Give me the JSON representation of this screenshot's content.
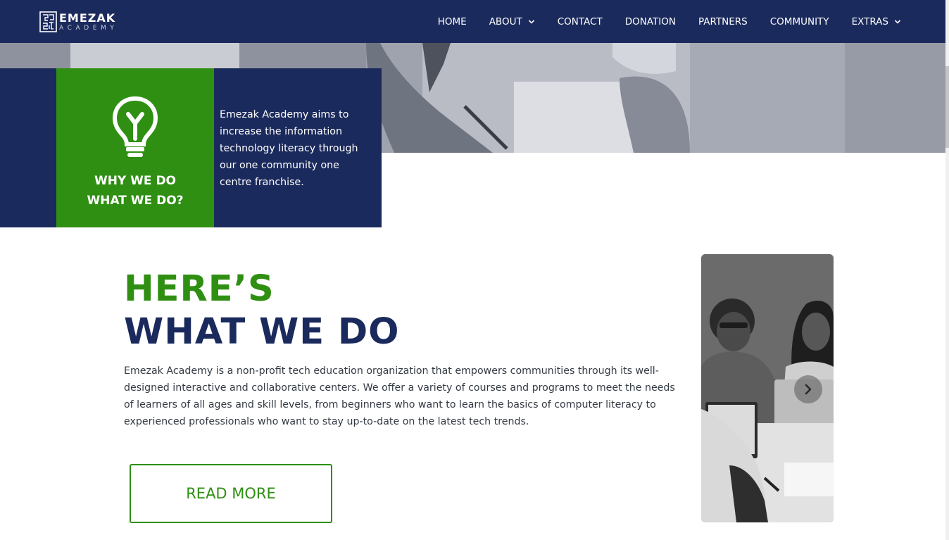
{
  "logo": {
    "name": "EMEZAK",
    "sub": "ACADEMY"
  },
  "nav": {
    "items": [
      {
        "label": "HOME",
        "dropdown": false
      },
      {
        "label": "ABOUT",
        "dropdown": true
      },
      {
        "label": "CONTACT",
        "dropdown": false
      },
      {
        "label": "DONATION",
        "dropdown": false
      },
      {
        "label": "PARTNERS",
        "dropdown": false
      },
      {
        "label": "COMMUNITY",
        "dropdown": false
      },
      {
        "label": "EXTRAS",
        "dropdown": true
      }
    ]
  },
  "why": {
    "title_line1": "WHY WE DO",
    "title_line2": "WHAT WE DO?",
    "text": "Emezak Academy aims to increase the information technology literacy through our one community one centre franchise.",
    "icon": "lightbulb-icon"
  },
  "main": {
    "heading_line1": "HERE’S",
    "heading_line2": "WHAT WE DO",
    "body": "Emezak Academy is a non-profit tech education organization that empowers communities through its well-designed interactive and collaborative centers. We offer a variety of courses and programs to meet the needs of learners of all ages and skill levels, from beginners who want to learn the basics of computer literacy to experienced professionals who want to stay up-to-date on the latest tech trends.",
    "read_more_label": "READ MORE"
  },
  "slider": {
    "next_icon": "chevron-right-icon"
  },
  "colors": {
    "navy": "#1b2a5c",
    "green": "#2f8f13",
    "white": "#ffffff"
  }
}
